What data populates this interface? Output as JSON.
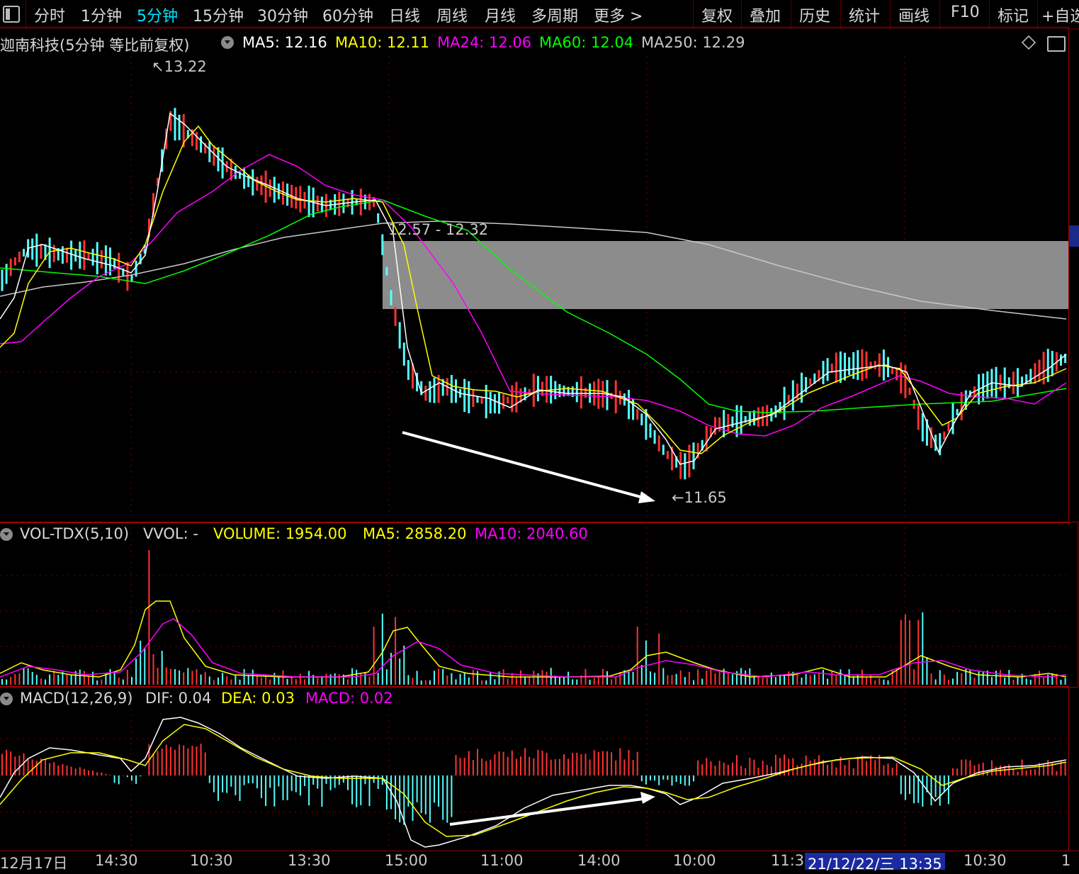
{
  "toolbar": {
    "menu_icon": "window-toggle-icon",
    "periods": [
      "分时",
      "1分钟",
      "5分钟",
      "15分钟",
      "30分钟",
      "60分钟",
      "日线",
      "周线",
      "月线",
      "多周期",
      "更多 >"
    ],
    "active_period": "5分钟",
    "right_buttons": [
      "复权",
      "叠加",
      "历史",
      "统计",
      "画线",
      "F10",
      "标记",
      "+自选"
    ]
  },
  "main_panel": {
    "title": "迦南科技(5分钟 等比前复权)",
    "ma5": "MA5: 12.16",
    "ma10": "MA10: 12.11",
    "ma24": "MA24: 12.06",
    "ma60": "MA60: 12.04",
    "ma250": "MA250: 12.29",
    "high_label": "13.22",
    "low_label": "11.65",
    "zone_label": "12.57 - 12.32",
    "colors": {
      "ma5": "#ffffff",
      "ma10": "#ffff00",
      "ma24": "#ff00ff",
      "ma60": "#00ff00",
      "ma250": "#c8c8c8",
      "up": "#ff3232",
      "down": "#54ffff",
      "zone": "#8c8c8c"
    }
  },
  "vol_panel": {
    "name": "VOL-TDX(5,10)",
    "vvol": "VVOL: -",
    "volume": "VOLUME: 1954.00",
    "ma5": "MA5: 2858.20",
    "ma10": "MA10: 2040.60"
  },
  "macd_panel": {
    "name": "MACD(12,26,9)",
    "dif": "DIF: 0.04",
    "dea": "DEA: 0.03",
    "macd": "MACD: 0.02"
  },
  "x_axis": {
    "labels": [
      "12月17日",
      "14:30",
      "10:30",
      "13:30",
      "15:00",
      "11:00",
      "14:00",
      "10:00",
      "11:3",
      "13:35",
      "10:30",
      "1"
    ],
    "highlight": "21/12/22/三"
  },
  "right_edge_marker": "1"
}
